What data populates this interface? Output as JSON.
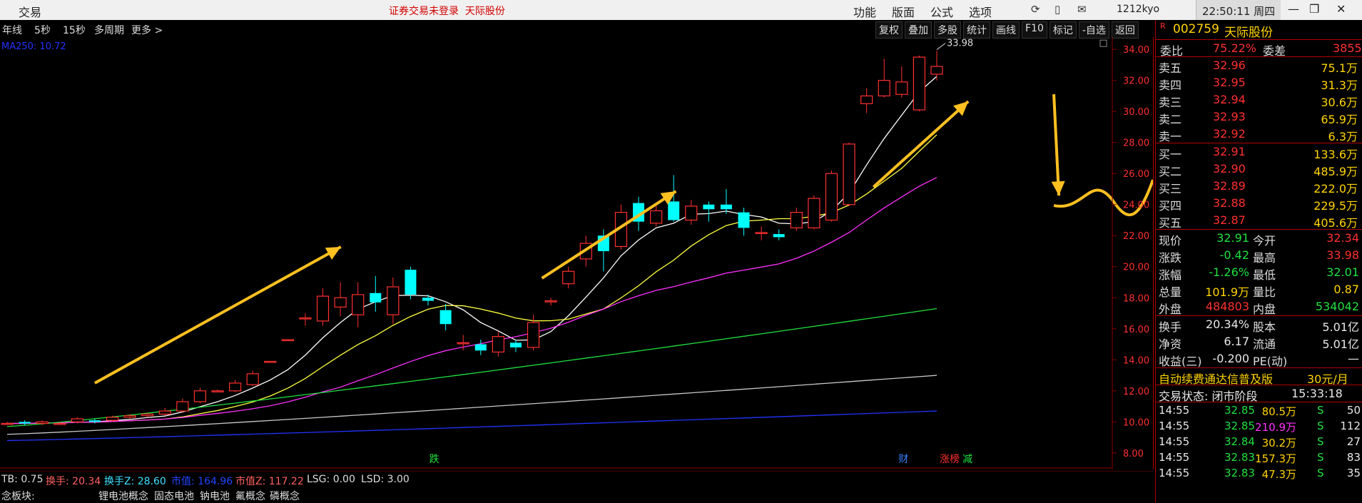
{
  "titlebar": {
    "app_title": "交易",
    "notice": "证券交易未登录",
    "notice_stock": "天际股份",
    "menus": [
      "功能",
      "版面",
      "公式",
      "选项"
    ],
    "user": "1212kyo",
    "clock": "22:50:11 周四"
  },
  "toolbar": {
    "periods": [
      "年线",
      "5秒",
      "15秒",
      "多周期",
      "更多 >"
    ],
    "tools": [
      "复权",
      "叠加",
      "多股",
      "统计",
      "画线",
      "F10",
      "标记",
      "-自选",
      "返回"
    ]
  },
  "chart": {
    "ma_label": "MA250: 10.72",
    "last_high_label": "33.98",
    "yaxis_ticks": [
      "34.00",
      "32.00",
      "30.00",
      "28.00",
      "26.00",
      "24.00",
      "22.00",
      "20.00",
      "18.00",
      "16.00",
      "14.00",
      "12.00",
      "10.00",
      "8.00"
    ],
    "markers": [
      {
        "text": "跌",
        "color": "#20e040"
      },
      {
        "text": "财",
        "color": "#3a7fff"
      },
      {
        "text": "涨榜",
        "color": "#ff3030"
      },
      {
        "text": "减",
        "color": "#20e040"
      }
    ],
    "colors": {
      "up": "#ff3030",
      "down": "#00ffff",
      "ma5": "#ffffff",
      "ma10": "#ffff40",
      "ma20": "#ff30ff",
      "ma60": "#20e040",
      "ma120": "#c8c8c8",
      "ma250": "#2233ff",
      "arrow": "#ffc020"
    }
  },
  "info": {
    "tb": "TB: 0.75",
    "turnover": "换手: 20.34",
    "turnover_z": "换手Z: 28.60",
    "mktcap": "市值: 164.96",
    "float_cap": "市值Z: 117.22",
    "lsg": "LSG: 0.00",
    "lsd": "LSD: 3.00"
  },
  "concepts": {
    "label": "念板块:",
    "items": [
      "锂电池概念",
      "固态电池",
      "钠电池",
      "氟概念",
      "磷概念"
    ]
  },
  "panel": {
    "r": "R",
    "code": "002759",
    "name": "天际股份",
    "webi_label": "委比",
    "webi": "75.22%",
    "weicha_label": "委差",
    "weicha": "3855",
    "asks": [
      {
        "label": "卖五",
        "price": "32.96",
        "vol": "75.1万"
      },
      {
        "label": "卖四",
        "price": "32.95",
        "vol": "31.3万"
      },
      {
        "label": "卖三",
        "price": "32.94",
        "vol": "30.6万"
      },
      {
        "label": "卖二",
        "price": "32.93",
        "vol": "65.9万"
      },
      {
        "label": "卖一",
        "price": "32.92",
        "vol": "6.3万"
      }
    ],
    "bids": [
      {
        "label": "买一",
        "price": "32.91",
        "vol": "133.6万"
      },
      {
        "label": "买二",
        "price": "32.90",
        "vol": "485.9万"
      },
      {
        "label": "买三",
        "price": "32.89",
        "vol": "222.0万"
      },
      {
        "label": "买四",
        "price": "32.88",
        "vol": "229.5万"
      },
      {
        "label": "买五",
        "price": "32.87",
        "vol": "405.6万"
      }
    ],
    "stats": [
      {
        "l1": "现价",
        "v1": "32.91",
        "c1": "green",
        "l2": "今开",
        "v2": "32.34",
        "c2": "red"
      },
      {
        "l1": "涨跌",
        "v1": "-0.42",
        "c1": "green",
        "l2": "最高",
        "v2": "33.98",
        "c2": "red"
      },
      {
        "l1": "涨幅",
        "v1": "-1.26%",
        "c1": "green",
        "l2": "最低",
        "v2": "32.01",
        "c2": "green"
      },
      {
        "l1": "总量",
        "v1": "101.9万",
        "c1": "yellow",
        "l2": "量比",
        "v2": "0.87",
        "c2": "yellow"
      },
      {
        "l1": "外盘",
        "v1": "484803",
        "c1": "red",
        "l2": "内盘",
        "v2": "534042",
        "c2": "green"
      }
    ],
    "stats2": [
      {
        "l1": "换手",
        "v1": "20.34%",
        "l2": "股本",
        "v2": "5.01亿"
      },
      {
        "l1": "净资",
        "v1": "6.17",
        "l2": "流通",
        "v2": "5.01亿"
      },
      {
        "l1": "收益(三)",
        "v1": "-0.200",
        "l2": "PE(动)",
        "v2": "—"
      }
    ],
    "ad_text": "自动续费通达信普及版",
    "ad_price": "30元/月",
    "status_label": "交易状态: 闭市阶段",
    "status_time": "15:33:18",
    "trades": [
      {
        "time": "14:55",
        "price": "32.85",
        "vol": "80.5万",
        "vcolor": "yellow",
        "side": "S",
        "n": "50"
      },
      {
        "time": "14:55",
        "price": "32.85",
        "vol": "210.9万",
        "vcolor": "magenta",
        "side": "S",
        "n": "112"
      },
      {
        "time": "14:55",
        "price": "32.84",
        "vol": "30.2万",
        "vcolor": "yellow",
        "side": "S",
        "n": "27"
      },
      {
        "time": "14:55",
        "price": "32.83",
        "vol": "157.3万",
        "vcolor": "yellow",
        "side": "S",
        "n": "83"
      },
      {
        "time": "14:55",
        "price": "32.83",
        "vol": "47.3万",
        "vcolor": "yellow",
        "side": "S",
        "n": "35"
      }
    ]
  }
}
